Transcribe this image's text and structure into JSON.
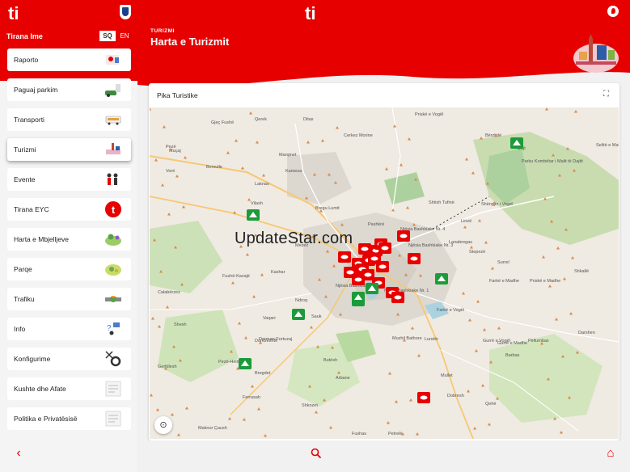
{
  "app": {
    "logo_text": "ti",
    "user_name": "Tirana Ime",
    "languages": [
      "SQ",
      "EN"
    ],
    "selected_language": "SQ"
  },
  "sidebar": {
    "items": [
      {
        "label": "Raporto"
      },
      {
        "label": "Paguaj parkim"
      },
      {
        "label": "Transporti"
      },
      {
        "label": "Turizmi"
      },
      {
        "label": "Evente"
      },
      {
        "label": "Tirana EYC"
      },
      {
        "label": "Harta e Mbjelljeve"
      },
      {
        "label": "Parqe"
      },
      {
        "label": "Trafiku"
      },
      {
        "label": "Info"
      },
      {
        "label": "Konfigurime"
      },
      {
        "label": "Kushte dhe Afate"
      },
      {
        "label": "Politika e Privatësisë"
      }
    ],
    "active_item": "Turizmi"
  },
  "header": {
    "breadcrumb": "TURIZMI",
    "title": "Harta e Turizmit"
  },
  "card": {
    "title": "Pika Turistike"
  },
  "map": {
    "labels": [
      "Gjeç Fushë",
      "Qerek",
      "Ditas",
      "Pezë",
      "Kameza",
      "Laknas",
      "Bregu Lumit",
      "Selitë e Malit",
      "Dajt",
      "Parku Kombëtar i Malit të Dajtit",
      "Shtish Tufinë",
      "Linzë",
      "Shëngjin i Vogël",
      "Njësia Bashkiake Nr. 4",
      "Njësia Bashkiake Nr. 3",
      "Njësia Bashkiake Nr. 2",
      "Njësia Bashkiake Nr. 1",
      "Farkë e Vogël",
      "Farkë e Madhe",
      "Priskë e Madhe",
      "Surrel",
      "Shkallë",
      "Lanabregas",
      "Stepezë",
      "Cerkez Morine",
      "Priskë e Vogël",
      "Bërzhitë",
      "Sauk",
      "Lundër",
      "Mullet",
      "Dobresh",
      "Qehë",
      "Arbane",
      "Petrelë",
      "Dorëzeshtë",
      "Gurrë e Vogël",
      "Gurrë e Madhe",
      "Barbas",
      "Pëllumbas",
      "Darshen",
      "Shesh",
      "Gerbllesh",
      "Fushas",
      "Maknor Çaush",
      "Pezë-Helmës",
      "Vaqarr",
      "Dorman-Fortuzaj",
      "Muzhil Bathore",
      "Butësh",
      "Ndroq",
      "Kashar",
      "Berxulle",
      "Mezez",
      "Vorë",
      "Muçaj",
      "Marqinet",
      "Bregdet",
      "Fushë-Kavajë",
      "Calabërzez",
      "Ferrasah",
      "Shkozet",
      "Vilash",
      "Pashkrë"
    ],
    "pin_color": "#e60000",
    "park_color": "#1c9b3a",
    "watermark": "UpdateStar.com"
  },
  "icons": {
    "back": "chevron-left-icon",
    "search": "search-icon",
    "home": "home-icon",
    "fullscreen": "fullscreen-icon",
    "locate": "locate-icon"
  }
}
